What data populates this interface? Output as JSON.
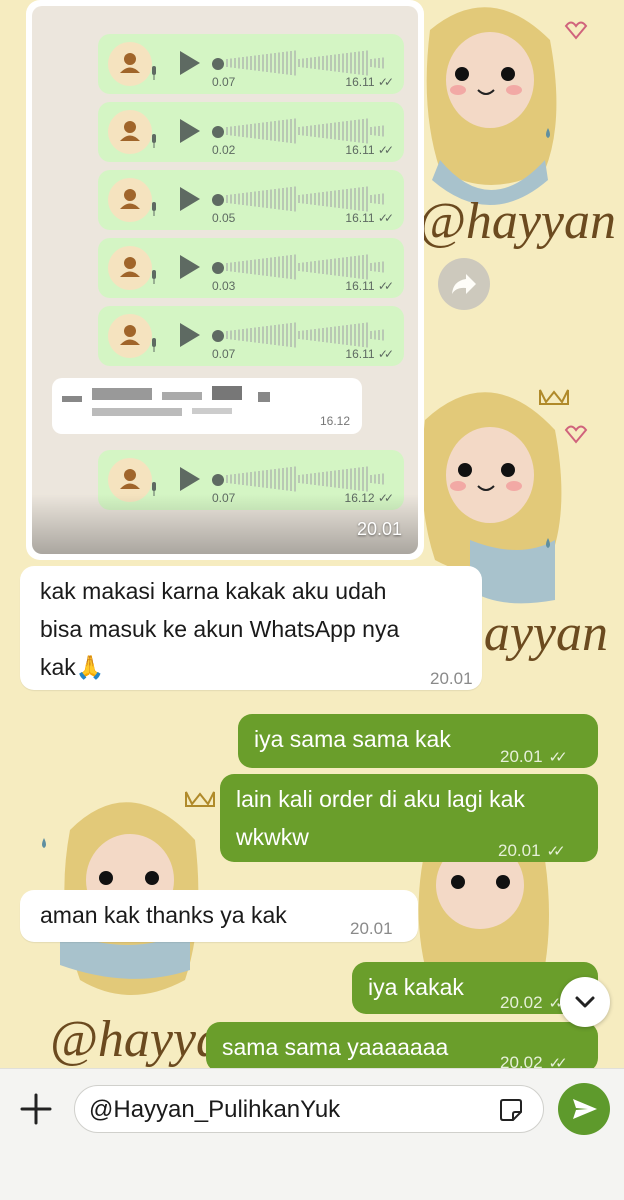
{
  "forwarded_image": {
    "voice_notes": [
      {
        "duration": "0.07",
        "time": "16.11"
      },
      {
        "duration": "0.02",
        "time": "16.11"
      },
      {
        "duration": "0.05",
        "time": "16.11"
      },
      {
        "duration": "0.03",
        "time": "16.11"
      },
      {
        "duration": "0.07",
        "time": "16.11"
      },
      {
        "duration": "0.07",
        "time": "16.12"
      }
    ],
    "redacted_message_time": "16.12",
    "image_time": "20.01"
  },
  "wallpaper_text": "@hayyan",
  "messages": [
    {
      "side": "in",
      "text_lines": [
        "kak makasi karna kakak aku udah",
        "bisa masuk ke akun WhatsApp nya",
        "kak🙏"
      ],
      "time": "20.01"
    },
    {
      "side": "out",
      "text_lines": [
        "iya sama sama kak"
      ],
      "time": "20.01",
      "ticks": "✓✓"
    },
    {
      "side": "out",
      "text_lines": [
        "lain kali order di aku lagi kak",
        "wkwkw"
      ],
      "time": "20.01",
      "ticks": "✓✓"
    },
    {
      "side": "in",
      "text_lines": [
        "aman kak thanks ya kak"
      ],
      "time": "20.01"
    },
    {
      "side": "out",
      "text_lines": [
        "iya kakak"
      ],
      "time": "20.02",
      "ticks": "✓✓"
    },
    {
      "side": "out",
      "text_lines": [
        "sama sama yaaaaaaa"
      ],
      "time": "20.02",
      "ticks": "✓✓"
    }
  ],
  "composer": {
    "text": "@Hayyan_PulihkanYuk",
    "plus_icon": "plus-icon",
    "sticker_icon": "sticker-icon",
    "send_icon": "send-icon"
  },
  "colors": {
    "wallpaper": "#f6ecc0",
    "outgoing_bubble": "#6a9e2b",
    "incoming_bubble": "#ffffff",
    "voice_note_bubble": "#d4f5c4",
    "send_button": "#5e9a2c"
  }
}
